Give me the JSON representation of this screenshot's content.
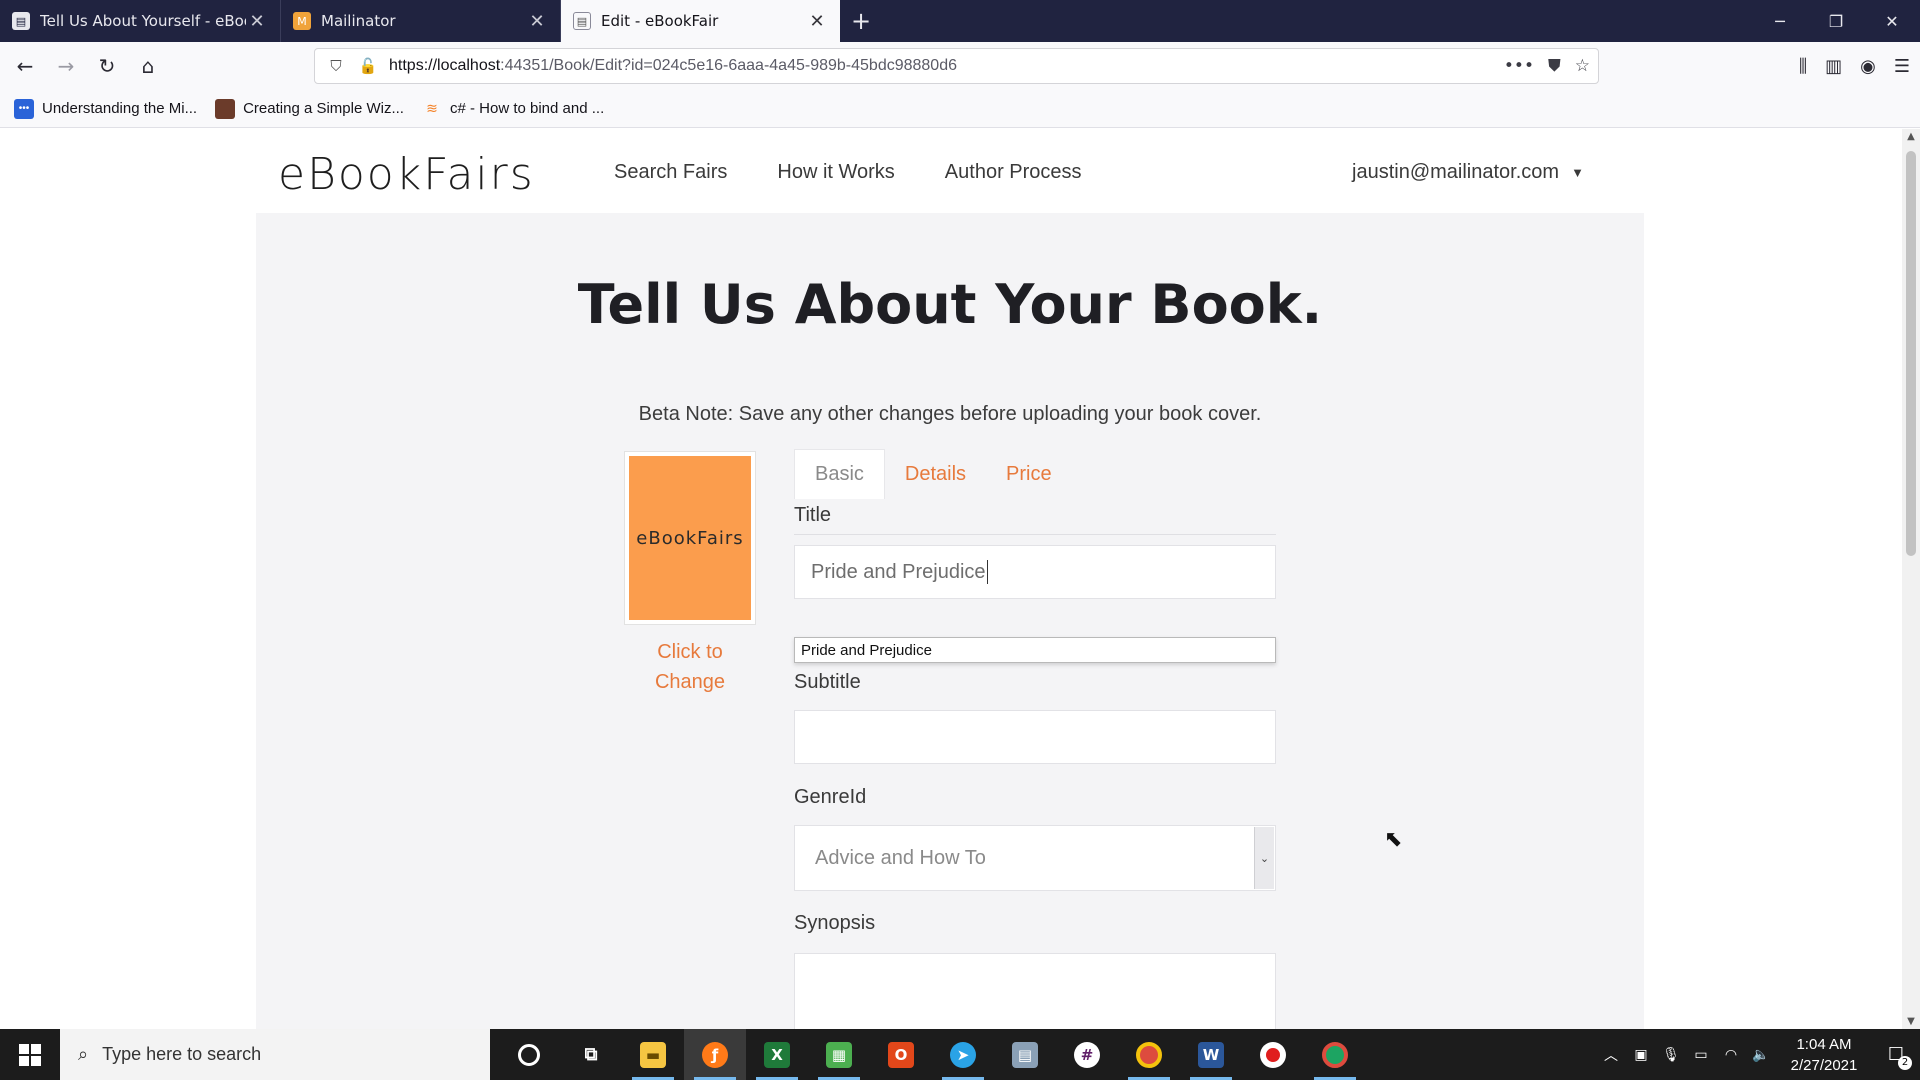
{
  "browser": {
    "tabs": [
      {
        "label": "Tell Us About Yourself - eBookF",
        "active": false
      },
      {
        "label": "Mailinator",
        "active": false
      },
      {
        "label": "Edit - eBookFair",
        "active": true
      }
    ],
    "url_host": "https://localhost",
    "url_rest": ":44351/Book/Edit?id=024c5e16-6aaa-4a45-989b-45bdc98880d6",
    "bookmarks": [
      {
        "label": "Understanding the Mi...",
        "color": "#2a63d8"
      },
      {
        "label": "Creating a Simple Wiz...",
        "color": "#6b3b2a"
      },
      {
        "label": "c# - How to bind and ...",
        "color": "#f48024"
      }
    ]
  },
  "site": {
    "logo": "eBookFairs",
    "nav": [
      "Search Fairs",
      "How it Works",
      "Author Process"
    ],
    "user": "jaustin@mailinator.com"
  },
  "page": {
    "headline": "Tell Us About Your Book.",
    "beta_note": "Beta Note: Save any other changes before uploading your book cover.",
    "cover_text": "eBookFairs",
    "change_link": "Click to Change",
    "tabs": [
      "Basic",
      "Details",
      "Price"
    ],
    "active_tab": "Basic",
    "form": {
      "title_label": "Title",
      "title_value": "Pride and Prejudice",
      "autocomplete_suggestion": "Pride and Prejudice",
      "subtitle_label": "Subtitle",
      "subtitle_value": "",
      "genre_label": "GenreId",
      "genre_value": "Advice and How To",
      "synopsis_label": "Synopsis",
      "synopsis_value": ""
    },
    "accent_color": "#e77a3c",
    "cover_color": "#fb9d4d"
  },
  "taskbar": {
    "search_placeholder": "Type here to search",
    "time": "1:04 AM",
    "date": "2/27/2021",
    "notification_count": "2",
    "apps": [
      "cortana-icon",
      "task-view-icon",
      "file-explorer-icon",
      "firefox-icon",
      "visual-studio-icon",
      "app-icon",
      "office-icon",
      "telegram-icon",
      "app-icon",
      "slack-icon",
      "chrome-icon",
      "word-icon",
      "record-icon",
      "chrome-icon"
    ]
  }
}
